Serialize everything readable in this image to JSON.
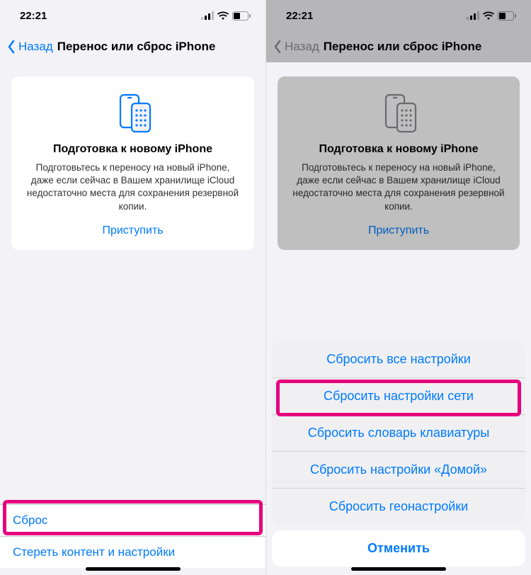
{
  "status": {
    "time": "22:21"
  },
  "nav": {
    "back": "Назад",
    "title": "Перенос или сброс iPhone"
  },
  "card": {
    "title": "Подготовка к новому iPhone",
    "desc": "Подготовьтесь к переносу на новый iPhone, даже если сейчас в Вашем хранилище iCloud недостаточно места для сохранения резервной копии.",
    "action": "Приступить"
  },
  "bottom": {
    "reset": "Сброс",
    "erase": "Стереть контент и настройки"
  },
  "sheet": {
    "items": [
      "Сбросить все настройки",
      "Сбросить настройки сети",
      "Сбросить словарь клавиатуры",
      "Сбросить настройки «Домой»",
      "Сбросить геонастройки"
    ],
    "cancel": "Отменить"
  },
  "colors": {
    "accent": "#007aff",
    "highlight": "#e6007e"
  }
}
